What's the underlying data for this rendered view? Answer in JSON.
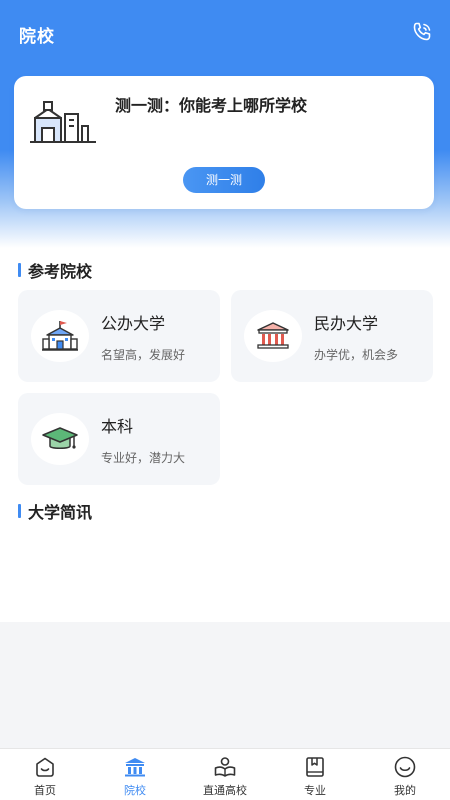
{
  "header": {
    "title": "院校",
    "phone_icon": "phone-icon"
  },
  "quiz": {
    "title": "测一测：你能考上哪所学校",
    "button_label": "测一测"
  },
  "reference_section": {
    "title": "参考院校",
    "categories": [
      {
        "name": "公办大学",
        "desc": "名望高，发展好",
        "icon": "public-university-icon"
      },
      {
        "name": "民办大学",
        "desc": "办学优，机会多",
        "icon": "private-university-icon"
      },
      {
        "name": "本科",
        "desc": "专业好，潜力大",
        "icon": "graduation-cap-icon"
      }
    ]
  },
  "news_section": {
    "title": "大学简讯"
  },
  "tabbar": {
    "active": 1,
    "items": [
      {
        "label": "首页",
        "icon": "home-icon"
      },
      {
        "label": "院校",
        "icon": "school-icon"
      },
      {
        "label": "直通高校",
        "icon": "direct-university-icon"
      },
      {
        "label": "专业",
        "icon": "book-icon"
      },
      {
        "label": "我的",
        "icon": "profile-icon"
      }
    ]
  },
  "colors": {
    "accent": "#3f8bf2",
    "card_bg": "#f4f6f9",
    "page_bg": "#f4f5f7"
  }
}
